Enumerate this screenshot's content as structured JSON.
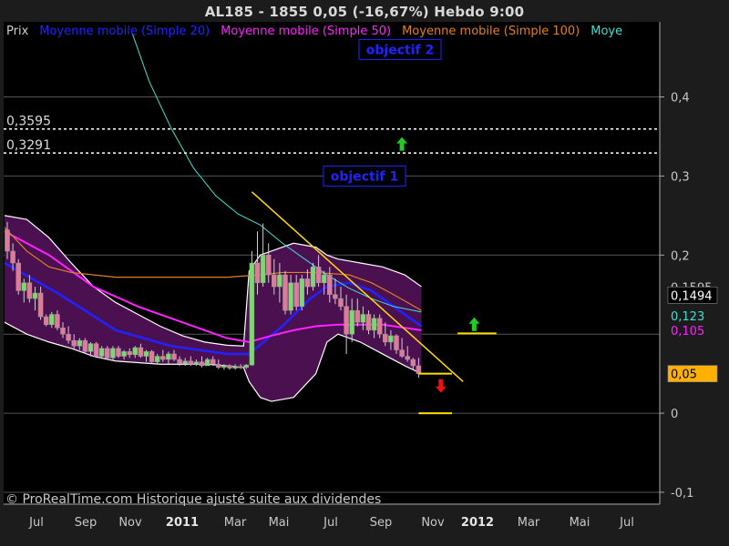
{
  "header": {
    "title": "AL185 - 1855     0,05 (-16,67%)     Hebdo  9:00"
  },
  "legend": [
    {
      "label": "Prix",
      "color": "#d0d0d0"
    },
    {
      "label": "Moyenne mobile (Simple 20)",
      "color": "#2222ff"
    },
    {
      "label": "Moyenne mobile (Simple 50)",
      "color": "#ff22ff"
    },
    {
      "label": "Moyenne mobile (Simple 100)",
      "color": "#e08020"
    },
    {
      "label": "Moye",
      "color": "#40e0d0"
    }
  ],
  "footer": {
    "copyright": "© ProRealTime.com Historique ajusté suite aux dividendes"
  },
  "colors": {
    "background": "#000000",
    "frame": "#1c1c1c",
    "bollinger_fill": "#4a1050",
    "ma20": "#2222ff",
    "ma50": "#ff22ff",
    "ma100": "#e08020",
    "ma200": "#40e0d0",
    "trendline": "#ffdd00",
    "candle_up": "#7ed870",
    "candle_down": "#e07a9a",
    "arrow_up": "#22cc22",
    "arrow_down": "#ee1111"
  },
  "chart_data": {
    "type": "candlestick",
    "ylim": [
      -0.1,
      0.45
    ],
    "y_ticks": [
      "0,4",
      "0,3",
      "0,2",
      "0",
      "-0,1"
    ],
    "x_ticks": [
      "Jul",
      "Sep",
      "Nov",
      "2011",
      "Mar",
      "Mai",
      "Jul",
      "Sep",
      "Nov",
      "2012",
      "Mar",
      "Mai",
      "Jul"
    ],
    "bold_x_ticks": [
      "2011",
      "2012"
    ],
    "horizontal_levels": [
      {
        "label": "0,3595",
        "value": 0.3595,
        "style": "dashed-white"
      },
      {
        "label": "0,3291",
        "value": 0.3291,
        "style": "dashed-white"
      }
    ],
    "right_axis_labels": [
      {
        "label": "0,1595",
        "value": 0.1595
      },
      {
        "label": "0,1494",
        "value": 0.1494,
        "box": "#000000",
        "text": "#ffffff"
      },
      {
        "label": "0,123",
        "value": 0.123,
        "text": "#40e0d0"
      },
      {
        "label": "0,105",
        "value": 0.105,
        "text": "#ff22ff"
      },
      {
        "label": "0,05",
        "value": 0.05,
        "box": "#ffb000",
        "text": "#000000"
      }
    ],
    "annotations": [
      {
        "label": "objectif 1",
        "value": 0.3,
        "color": "#2222ff"
      },
      {
        "label": "objectif 2",
        "value": 0.46,
        "color": "#2222ff"
      }
    ],
    "ohlc": [
      [
        0.232,
        0.242,
        0.195,
        0.205
      ],
      [
        0.205,
        0.215,
        0.18,
        0.19
      ],
      [
        0.19,
        0.195,
        0.15,
        0.155
      ],
      [
        0.155,
        0.17,
        0.14,
        0.165
      ],
      [
        0.165,
        0.175,
        0.14,
        0.145
      ],
      [
        0.145,
        0.16,
        0.13,
        0.152
      ],
      [
        0.152,
        0.16,
        0.118,
        0.122
      ],
      [
        0.122,
        0.125,
        0.11,
        0.112
      ],
      [
        0.112,
        0.128,
        0.108,
        0.125
      ],
      [
        0.125,
        0.13,
        0.105,
        0.108
      ],
      [
        0.108,
        0.115,
        0.095,
        0.1
      ],
      [
        0.1,
        0.11,
        0.088,
        0.092
      ],
      [
        0.092,
        0.1,
        0.08,
        0.085
      ],
      [
        0.085,
        0.095,
        0.08,
        0.092
      ],
      [
        0.092,
        0.095,
        0.075,
        0.078
      ],
      [
        0.078,
        0.09,
        0.072,
        0.088
      ],
      [
        0.088,
        0.09,
        0.07,
        0.072
      ],
      [
        0.072,
        0.085,
        0.07,
        0.082
      ],
      [
        0.082,
        0.085,
        0.068,
        0.07
      ],
      [
        0.07,
        0.085,
        0.066,
        0.082
      ],
      [
        0.082,
        0.085,
        0.07,
        0.072
      ],
      [
        0.072,
        0.08,
        0.068,
        0.078
      ],
      [
        0.078,
        0.082,
        0.07,
        0.074
      ],
      [
        0.074,
        0.085,
        0.07,
        0.083
      ],
      [
        0.083,
        0.088,
        0.07,
        0.072
      ],
      [
        0.072,
        0.08,
        0.065,
        0.078
      ],
      [
        0.078,
        0.08,
        0.062,
        0.065
      ],
      [
        0.065,
        0.075,
        0.062,
        0.072
      ],
      [
        0.072,
        0.08,
        0.065,
        0.068
      ],
      [
        0.068,
        0.078,
        0.062,
        0.075
      ],
      [
        0.075,
        0.08,
        0.066,
        0.068
      ],
      [
        0.068,
        0.072,
        0.06,
        0.063
      ],
      [
        0.063,
        0.07,
        0.06,
        0.066
      ],
      [
        0.066,
        0.072,
        0.06,
        0.062
      ],
      [
        0.062,
        0.068,
        0.06,
        0.065
      ],
      [
        0.065,
        0.072,
        0.058,
        0.06
      ],
      [
        0.06,
        0.07,
        0.06,
        0.068
      ],
      [
        0.068,
        0.072,
        0.06,
        0.062
      ],
      [
        0.062,
        0.068,
        0.056,
        0.058
      ],
      [
        0.058,
        0.062,
        0.055,
        0.06
      ],
      [
        0.06,
        0.062,
        0.055,
        0.057
      ],
      [
        0.057,
        0.062,
        0.055,
        0.059
      ],
      [
        0.059,
        0.062,
        0.056,
        0.058
      ],
      [
        0.058,
        0.062,
        0.056,
        0.061
      ],
      [
        0.061,
        0.205,
        0.06,
        0.19
      ],
      [
        0.19,
        0.23,
        0.15,
        0.165
      ],
      [
        0.165,
        0.24,
        0.16,
        0.2
      ],
      [
        0.2,
        0.215,
        0.165,
        0.175
      ],
      [
        0.175,
        0.195,
        0.15,
        0.16
      ],
      [
        0.16,
        0.19,
        0.14,
        0.175
      ],
      [
        0.175,
        0.18,
        0.125,
        0.13
      ],
      [
        0.13,
        0.175,
        0.125,
        0.165
      ],
      [
        0.165,
        0.175,
        0.13,
        0.135
      ],
      [
        0.135,
        0.175,
        0.13,
        0.17
      ],
      [
        0.17,
        0.182,
        0.15,
        0.16
      ],
      [
        0.16,
        0.19,
        0.155,
        0.185
      ],
      [
        0.185,
        0.2,
        0.16,
        0.165
      ],
      [
        0.165,
        0.18,
        0.15,
        0.175
      ],
      [
        0.175,
        0.185,
        0.14,
        0.15
      ],
      [
        0.15,
        0.17,
        0.138,
        0.145
      ],
      [
        0.145,
        0.16,
        0.13,
        0.135
      ],
      [
        0.135,
        0.15,
        0.075,
        0.1
      ],
      [
        0.1,
        0.145,
        0.09,
        0.13
      ],
      [
        0.13,
        0.145,
        0.11,
        0.115
      ],
      [
        0.115,
        0.135,
        0.105,
        0.125
      ],
      [
        0.125,
        0.13,
        0.1,
        0.105
      ],
      [
        0.105,
        0.125,
        0.095,
        0.12
      ],
      [
        0.12,
        0.125,
        0.095,
        0.1
      ],
      [
        0.1,
        0.115,
        0.085,
        0.09
      ],
      [
        0.09,
        0.105,
        0.08,
        0.098
      ],
      [
        0.098,
        0.1,
        0.075,
        0.08
      ],
      [
        0.08,
        0.095,
        0.07,
        0.072
      ],
      [
        0.072,
        0.085,
        0.065,
        0.068
      ],
      [
        0.068,
        0.07,
        0.055,
        0.06
      ],
      [
        0.06,
        0.07,
        0.045,
        0.05
      ]
    ],
    "series": [
      {
        "name": "Moyenne mobile (Simple 20)",
        "x": [
          0,
          10,
          20,
          30,
          40,
          44,
          50,
          55,
          58,
          62,
          66,
          70,
          75
        ],
        "values": [
          0.19,
          0.15,
          0.105,
          0.085,
          0.075,
          0.075,
          0.11,
          0.145,
          0.16,
          0.165,
          0.155,
          0.135,
          0.11
        ]
      },
      {
        "name": "Moyenne mobile (Simple 50)",
        "x": [
          0,
          8,
          16,
          24,
          32,
          40,
          44,
          48,
          52,
          56,
          60,
          64,
          68,
          72,
          75
        ],
        "values": [
          0.23,
          0.2,
          0.16,
          0.135,
          0.115,
          0.095,
          0.09,
          0.098,
          0.105,
          0.11,
          0.112,
          0.112,
          0.112,
          0.108,
          0.105
        ]
      },
      {
        "name": "Moyenne mobile (Simple 100)",
        "x": [
          0,
          4,
          8,
          12,
          20,
          30,
          40,
          46,
          50,
          56,
          62,
          66,
          70,
          75
        ],
        "values": [
          0.235,
          0.205,
          0.185,
          0.178,
          0.172,
          0.172,
          0.172,
          0.175,
          0.178,
          0.178,
          0.175,
          0.165,
          0.15,
          0.13
        ]
      },
      {
        "name": "Moye",
        "x": [
          23,
          26,
          30,
          34,
          38,
          42,
          46,
          50,
          54,
          58,
          62,
          66,
          70,
          75
        ],
        "values": [
          0.48,
          0.42,
          0.36,
          0.31,
          0.275,
          0.252,
          0.238,
          0.215,
          0.195,
          0.175,
          0.158,
          0.145,
          0.135,
          0.128
        ]
      },
      {
        "name": "bollinger-upper",
        "x": [
          0,
          4,
          8,
          12,
          16,
          20,
          24,
          28,
          32,
          36,
          40,
          43,
          44,
          46,
          48,
          52,
          56,
          58,
          60,
          64,
          68,
          72,
          75
        ],
        "values": [
          0.25,
          0.245,
          0.222,
          0.19,
          0.16,
          0.14,
          0.125,
          0.11,
          0.098,
          0.09,
          0.086,
          0.085,
          0.18,
          0.2,
          0.205,
          0.215,
          0.21,
          0.2,
          0.195,
          0.19,
          0.185,
          0.175,
          0.16
        ]
      },
      {
        "name": "bollinger-lower",
        "x": [
          0,
          4,
          8,
          12,
          16,
          20,
          24,
          28,
          32,
          36,
          40,
          43,
          44,
          46,
          48,
          52,
          56,
          58,
          60,
          64,
          68,
          72,
          75
        ],
        "values": [
          0.115,
          0.1,
          0.09,
          0.082,
          0.072,
          0.066,
          0.064,
          0.062,
          0.062,
          0.062,
          0.06,
          0.058,
          0.04,
          0.02,
          0.015,
          0.02,
          0.05,
          0.09,
          0.1,
          0.09,
          0.075,
          0.06,
          0.05
        ]
      },
      {
        "name": "trendline",
        "x": [
          44,
          82
        ],
        "values": [
          0.28,
          0.04
        ]
      }
    ],
    "support_segments": [
      {
        "x": [
          74,
          80
        ],
        "value": 0.05
      },
      {
        "x": [
          74,
          80
        ],
        "value": 0.0
      },
      {
        "x": [
          81,
          88
        ],
        "value": 0.101
      }
    ],
    "arrows": [
      {
        "direction": "up",
        "x": 71,
        "value": 0.34
      },
      {
        "direction": "up",
        "x": 84,
        "value": 0.112
      },
      {
        "direction": "down",
        "x": 78,
        "value": 0.035
      }
    ]
  }
}
